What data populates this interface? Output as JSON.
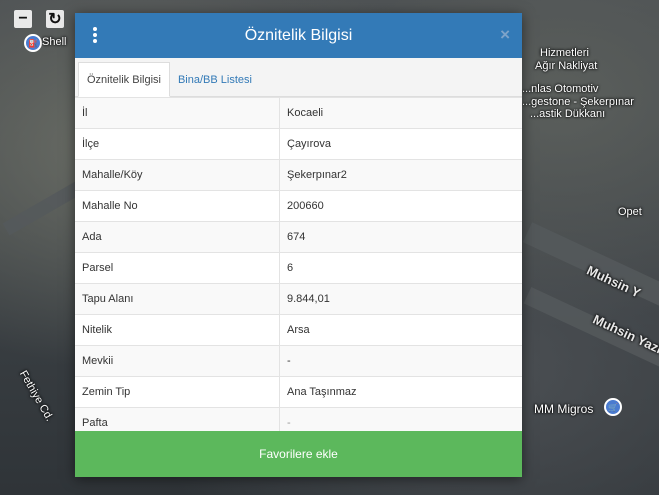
{
  "map": {
    "labels": {
      "shell": "Shell",
      "hizmetleri": "Hizmetleri",
      "agir_nakliyat": "Ağır Nakliyat",
      "otomotiv": "...nlas Otomotiv",
      "gestone": "...gestone - Şekerpınar",
      "lastik": "...astik Dükkanı",
      "opet": "Opet",
      "muhsin1": "Muhsin Y",
      "muhsin2": "Muhsin Yazıc",
      "fethiye": "Fethiye Cd.",
      "mm_migros": "MM Migros",
      "street_side": "...ıc"
    },
    "toolbar": {
      "zoom_out": "−",
      "refresh": "↻"
    }
  },
  "modal": {
    "title": "Öznitelik Bilgisi",
    "close_label": "×",
    "tabs": [
      {
        "label": "Öznitelik Bilgisi",
        "active": true
      },
      {
        "label": "Bina/BB Listesi",
        "active": false
      }
    ],
    "rows": [
      {
        "key": "İl",
        "value": "Kocaeli"
      },
      {
        "key": "İlçe",
        "value": "Çayırova"
      },
      {
        "key": "Mahalle/Köy",
        "value": "Şekerpınar2"
      },
      {
        "key": "Mahalle No",
        "value": "200660"
      },
      {
        "key": "Ada",
        "value": "674"
      },
      {
        "key": "Parsel",
        "value": "6"
      },
      {
        "key": "Tapu Alanı",
        "value": "9.844,01"
      },
      {
        "key": "Nitelik",
        "value": "Arsa"
      },
      {
        "key": "Mevkii",
        "value": "-"
      },
      {
        "key": "Zemin Tip",
        "value": "Ana Taşınmaz"
      },
      {
        "key": "Pafta",
        "value": "-"
      }
    ],
    "favorite_button": "Favorilere ekle"
  },
  "colors": {
    "header": "#337ab7",
    "button": "#5cb85c"
  }
}
